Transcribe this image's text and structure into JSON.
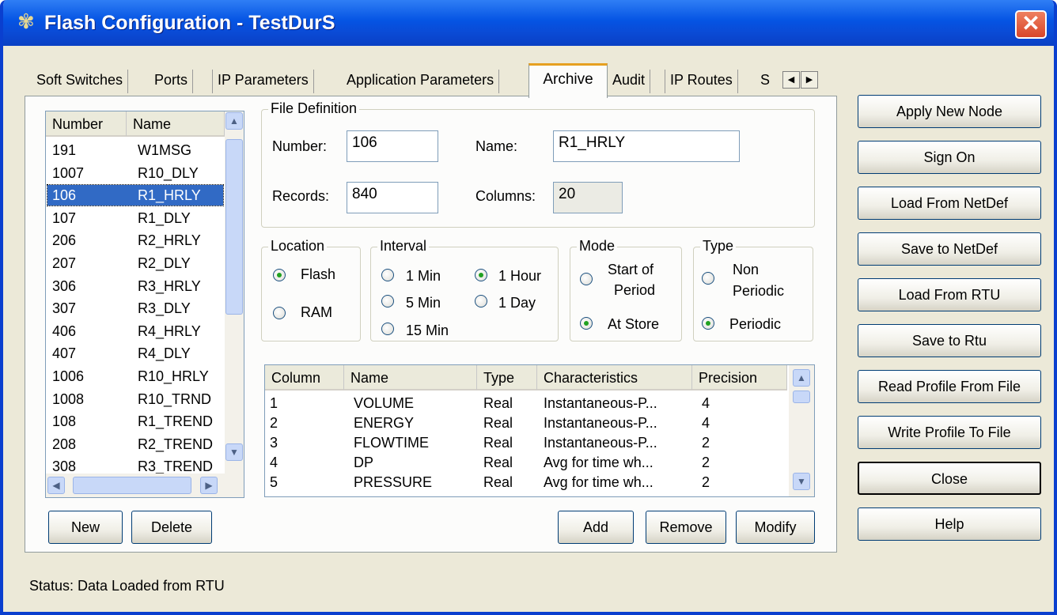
{
  "window": {
    "title": "Flash Configuration - TestDurS",
    "close_glyph": "✕"
  },
  "tabs": [
    "Soft Switches",
    "Ports",
    "IP Parameters",
    "Application Parameters",
    "Archive",
    "Audit",
    "IP Routes",
    "S"
  ],
  "active_tab": "Archive",
  "archive_list": {
    "headers": [
      "Number",
      "Name"
    ],
    "rows": [
      [
        "191",
        "W1MSG"
      ],
      [
        "1007",
        "R10_DLY"
      ],
      [
        "106",
        "R1_HRLY"
      ],
      [
        "107",
        "R1_DLY"
      ],
      [
        "206",
        "R2_HRLY"
      ],
      [
        "207",
        "R2_DLY"
      ],
      [
        "306",
        "R3_HRLY"
      ],
      [
        "307",
        "R3_DLY"
      ],
      [
        "406",
        "R4_HRLY"
      ],
      [
        "407",
        "R4_DLY"
      ],
      [
        "1006",
        "R10_HRLY"
      ],
      [
        "1008",
        "R10_TRND"
      ],
      [
        "108",
        "R1_TREND"
      ],
      [
        "208",
        "R2_TREND"
      ],
      [
        "308",
        "R3_TREND"
      ]
    ],
    "selected_index": 2
  },
  "file_definition": {
    "legend": "File Definition",
    "number_label": "Number:",
    "number_value": "106",
    "name_label": "Name:",
    "name_value": "R1_HRLY",
    "records_label": "Records:",
    "records_value": "840",
    "columns_label": "Columns:",
    "columns_value": "20"
  },
  "location": {
    "legend": "Location",
    "options": [
      "Flash",
      "RAM"
    ],
    "selected": "Flash"
  },
  "interval": {
    "legend": "Interval",
    "options": [
      "1 Min",
      "1 Hour",
      "5 Min",
      "1 Day",
      "15 Min"
    ],
    "selected": "1 Hour"
  },
  "mode": {
    "legend": "Mode",
    "start_of": "Start of",
    "period": "Period",
    "at_store": "At Store",
    "selected": "At Store"
  },
  "type": {
    "legend": "Type",
    "non": "Non",
    "periodic_l2": "Periodic",
    "periodic": "Periodic",
    "selected": "Periodic"
  },
  "columns_table": {
    "headers": [
      "Column",
      "Name",
      "Type",
      "Characteristics",
      "Precision"
    ],
    "rows": [
      [
        "1",
        "VOLUME",
        "Real",
        "Instantaneous-P...",
        "4"
      ],
      [
        "2",
        "ENERGY",
        "Real",
        "Instantaneous-P...",
        "4"
      ],
      [
        "3",
        "FLOWTIME",
        "Real",
        "Instantaneous-P...",
        "2"
      ],
      [
        "4",
        "DP",
        "Real",
        "Avg for time wh...",
        "2"
      ],
      [
        "5",
        "PRESSURE",
        "Real",
        "Avg for time wh...",
        "2"
      ]
    ]
  },
  "buttons": {
    "new": "New",
    "delete": "Delete",
    "add": "Add",
    "remove": "Remove",
    "modify": "Modify"
  },
  "side_buttons": [
    "Apply New Node",
    "Sign On",
    "Load From NetDef",
    "Save to NetDef",
    "Load From RTU",
    "Save to Rtu",
    "Read Profile From File",
    "Write Profile To File",
    "Close",
    "Help"
  ],
  "status": "Status:  Data Loaded from RTU",
  "icons": {
    "app": "✾",
    "scroll_up": "▲",
    "scroll_down": "▼",
    "scroll_left": "◀",
    "scroll_right": "▶"
  }
}
